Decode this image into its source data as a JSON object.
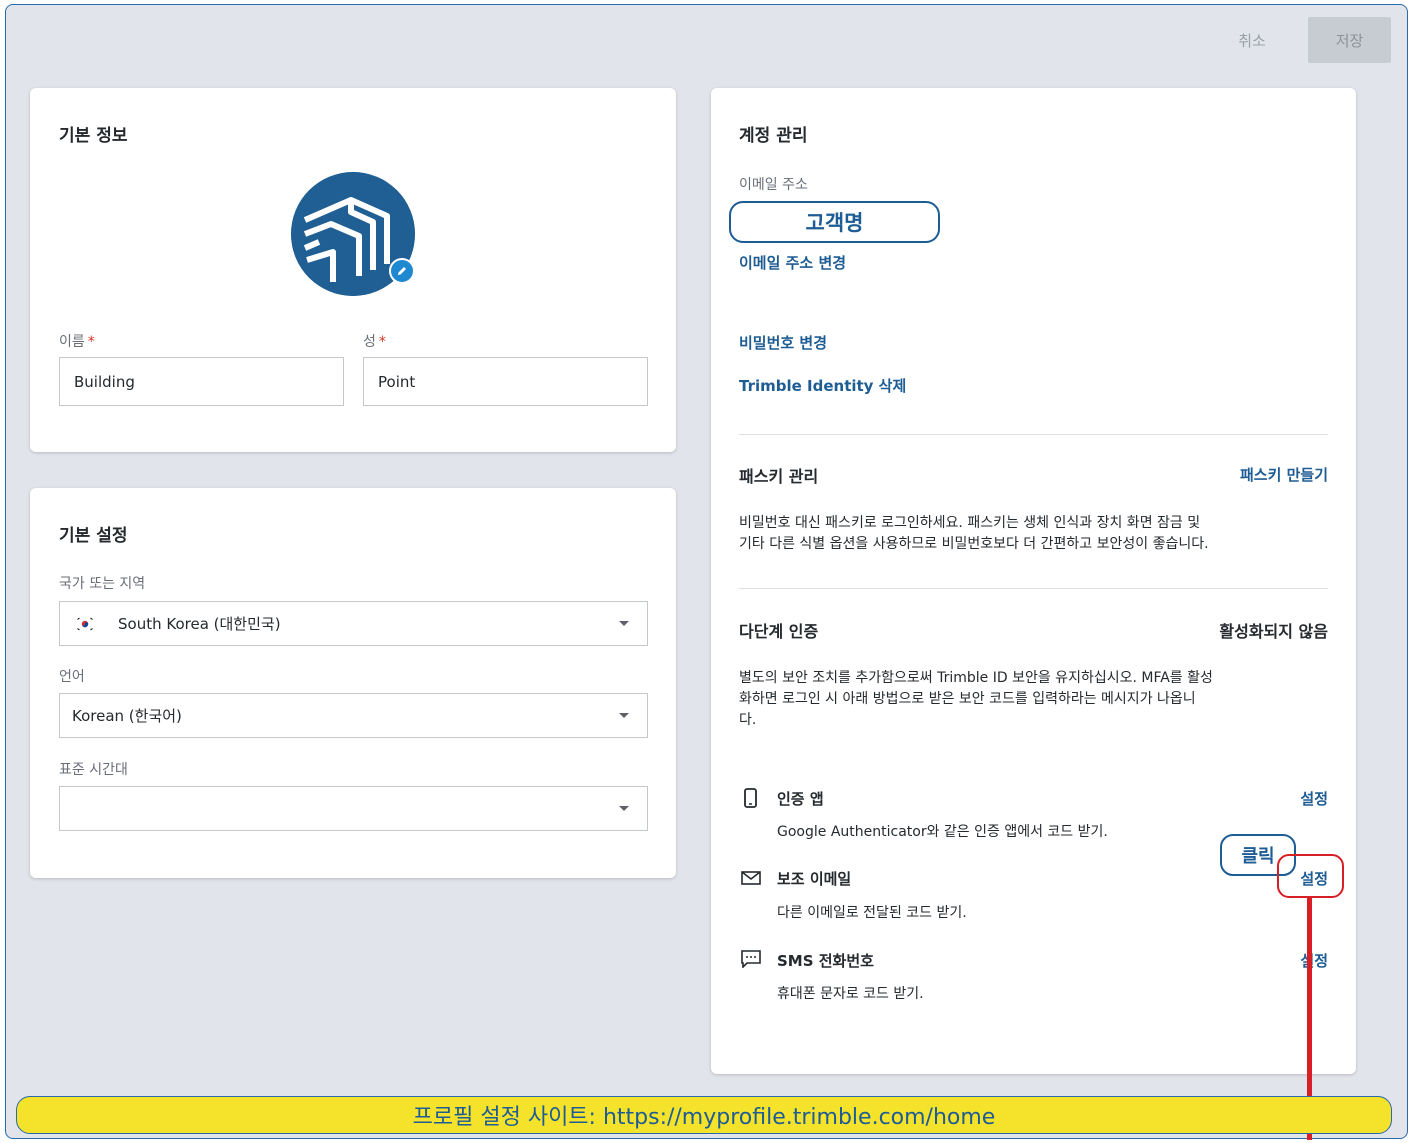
{
  "header": {
    "cancel_label": "취소",
    "save_label": "저장"
  },
  "basic_info": {
    "title": "기본 정보",
    "first_name_label": "이름",
    "last_name_label": "성",
    "required_mark": "*",
    "first_name_value": "Building",
    "last_name_value": "Point"
  },
  "basic_settings": {
    "title": "기본 설정",
    "country_label": "국가 또는 지역",
    "country_value": "South Korea (대한민국)",
    "language_label": "언어",
    "language_value": "Korean (한국어)",
    "timezone_label": "표준 시간대",
    "timezone_value": ""
  },
  "account": {
    "title": "계정 관리",
    "email_label": "이메일 주소",
    "change_email_link": "이메일 주소 변경",
    "change_password_link": "비밀번호 변경",
    "delete_identity_link": "Trimble Identity 삭제",
    "passkey_title": "패스키 관리",
    "passkey_create_link": "패스키 만들기",
    "passkey_desc_line1": "비밀번호 대신 패스키로 로그인하세요. 패스키는 생체 인식과 장치 화면 잠금 및",
    "passkey_desc_line2": "기타 다른 식별 옵션을 사용하므로 비밀번호보다 더 간편하고 보안성이 좋습니다.",
    "mfa_title": "다단계 인증",
    "mfa_status": "활성화되지 않음",
    "mfa_desc_line1": "별도의 보안 조치를 추가함으로써 Trimble ID 보안을 유지하십시오. MFA를 활성",
    "mfa_desc_line2": "화하면 로그인 시 아래 방법으로 받은 보안 코드를 입력하라는 메시지가 나옵니",
    "mfa_desc_line3": "다.",
    "methods": [
      {
        "title": "인증 앱",
        "desc": "Google Authenticator와 같은 인증 앱에서 코드 받기.",
        "action": "설정",
        "icon": "phone-icon"
      },
      {
        "title": "보조 이메일",
        "desc": "다른 이메일로 전달된 코드 받기.",
        "action": "설정",
        "icon": "mail-icon"
      },
      {
        "title": "SMS 전화번호",
        "desc": "휴대폰 문자로 코드 받기.",
        "action": "설정",
        "icon": "message-icon"
      }
    ]
  },
  "annotations": {
    "customer_name": "고객명",
    "click": "클릭",
    "site_banner": "프로필 설정 사이트: https://myprofile.trimble.com/home",
    "accent_color": "#1e5c94",
    "highlight_color": "#d81f26",
    "banner_color": "#f5e22a"
  }
}
